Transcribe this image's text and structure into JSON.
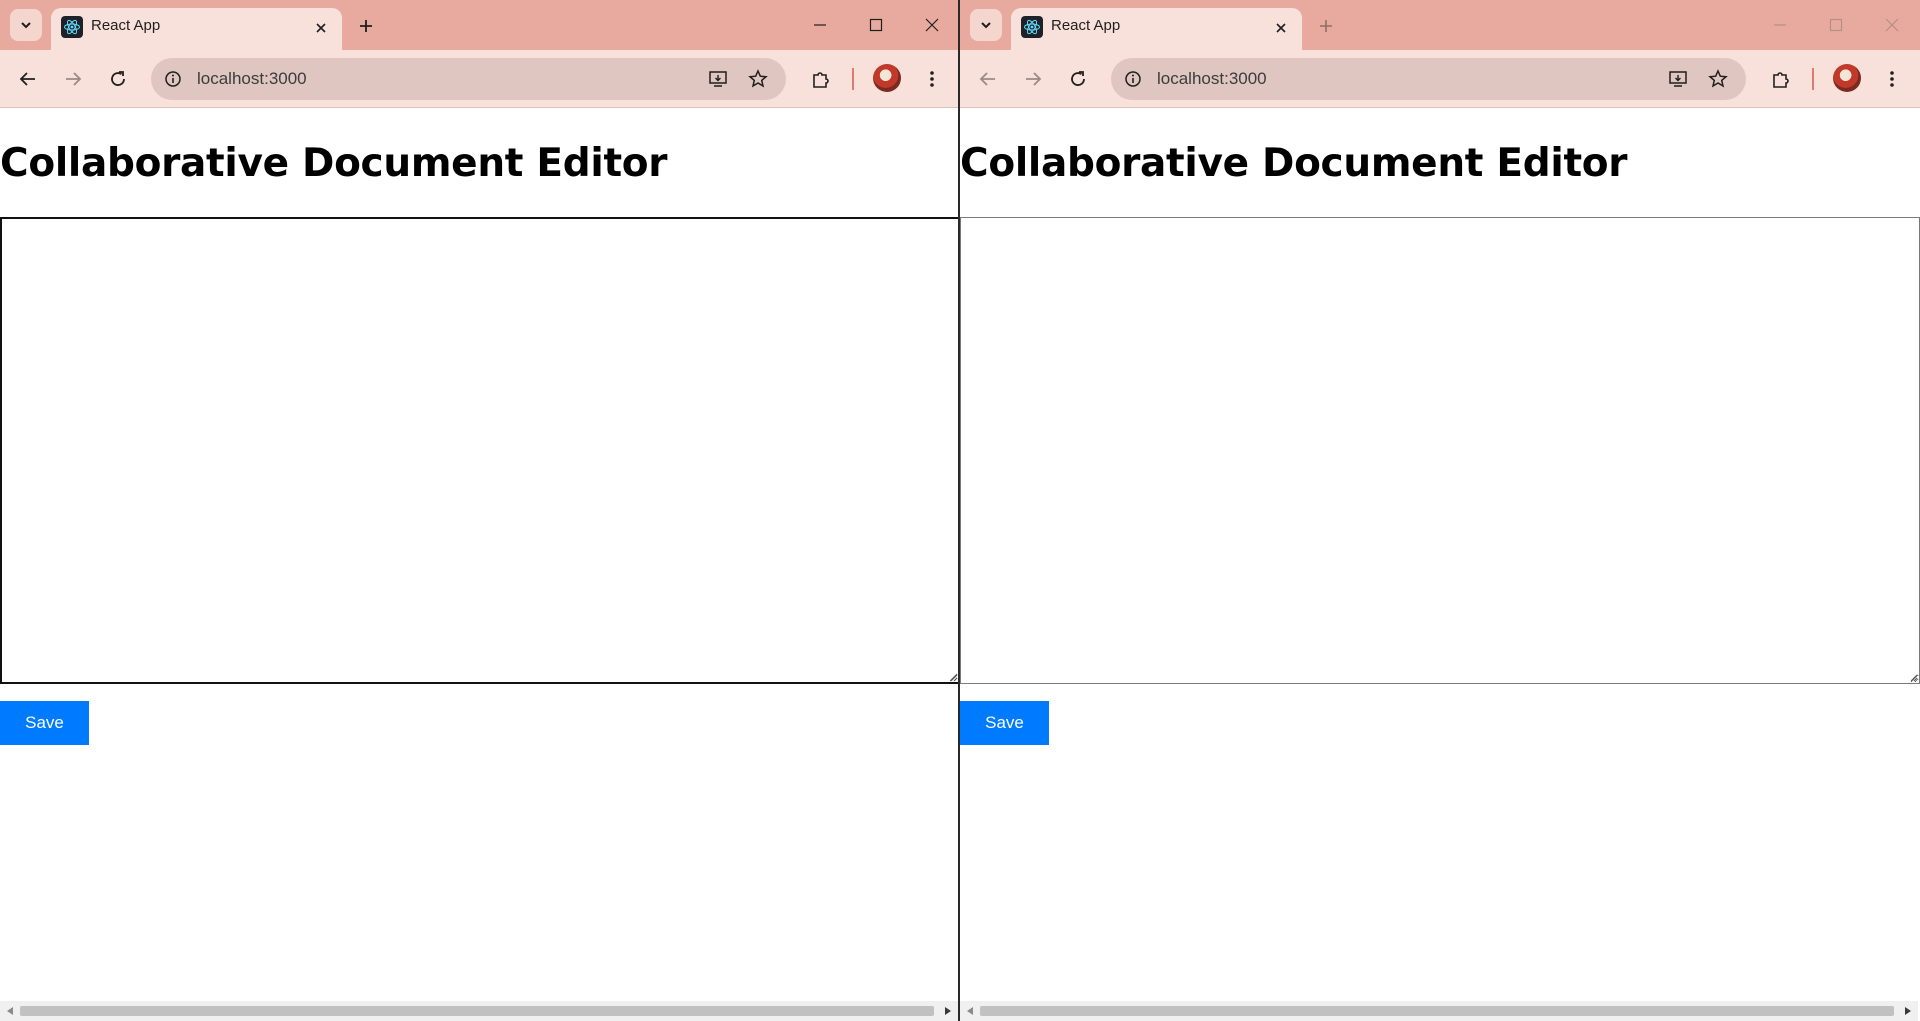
{
  "windows": [
    {
      "tab": {
        "title": "React App"
      },
      "address": {
        "url": "localhost:3000"
      },
      "page": {
        "title": "Collaborative Document Editor",
        "editor_value": "",
        "save_label": "Save"
      }
    },
    {
      "tab": {
        "title": "React App"
      },
      "address": {
        "url": "localhost:3000"
      },
      "page": {
        "title": "Collaborative Document Editor",
        "editor_value": "",
        "save_label": "Save"
      }
    }
  ],
  "icons": {
    "tab_search": "chevron-down-icon",
    "favicon": "react-logo-icon",
    "tab_close": "close-icon",
    "new_tab": "plus-icon",
    "minimize": "minimize-icon",
    "maximize": "maximize-icon",
    "close_window": "close-icon",
    "back": "arrow-left-icon",
    "forward": "arrow-right-icon",
    "reload": "reload-icon",
    "site_info": "info-icon",
    "install": "install-app-icon",
    "bookmark": "star-icon",
    "extensions": "puzzle-icon",
    "menu": "kebab-menu-icon"
  },
  "colors": {
    "tabstrip_bg": "#e8aa9e",
    "toolbar_bg": "#f8e0db",
    "omnibox_bg": "#dfc6c0",
    "save_button_bg": "#007bff",
    "save_button_text": "#ffffff"
  }
}
